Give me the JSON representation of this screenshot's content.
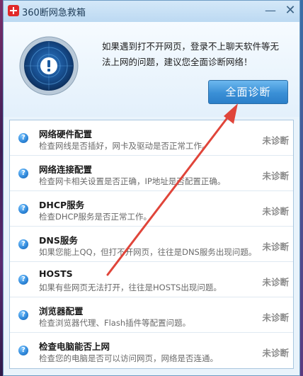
{
  "window": {
    "title": "360断网急救箱"
  },
  "header": {
    "message": "如果遇到打不开网页，登录不上聊天软件等无法上网的问题，建议您全面诊断网络！",
    "diagnose_label": "全面诊断"
  },
  "items": [
    {
      "title": "网络硬件配置",
      "desc": "检查网线是否插好，网卡及驱动是否正常工作。",
      "status": "未诊断"
    },
    {
      "title": "网络连接配置",
      "desc": "检查网卡相关设置是否正确，IP地址是否配置正确。",
      "status": "未诊断"
    },
    {
      "title": "DHCP服务",
      "desc": "检查DHCP服务是否正常工作。",
      "status": "未诊断"
    },
    {
      "title": "DNS服务",
      "desc": "如果您能上QQ，但打不开网页，往往是DNS服务出现问题。",
      "status": "未诊断"
    },
    {
      "title": "HOSTS",
      "desc": "如果有些网页无法打开，往往是HOSTS出现问题。",
      "status": "未诊断"
    },
    {
      "title": "浏览器配置",
      "desc": "检查浏览器代理、Flash插件等配置问题。",
      "status": "未诊断"
    },
    {
      "title": "检查电脑能否上网",
      "desc": "检查您的电脑是否可以访问网页，网络是否连通。",
      "status": "未诊断"
    }
  ],
  "icons": {
    "app": "first-aid-icon",
    "minimize": "minimize-icon",
    "close": "close-icon",
    "radar": "alert-radar-icon",
    "item": "question-icon"
  },
  "colors": {
    "accent": "#3a8fd6",
    "annotation_arrow": "#e0453a"
  }
}
